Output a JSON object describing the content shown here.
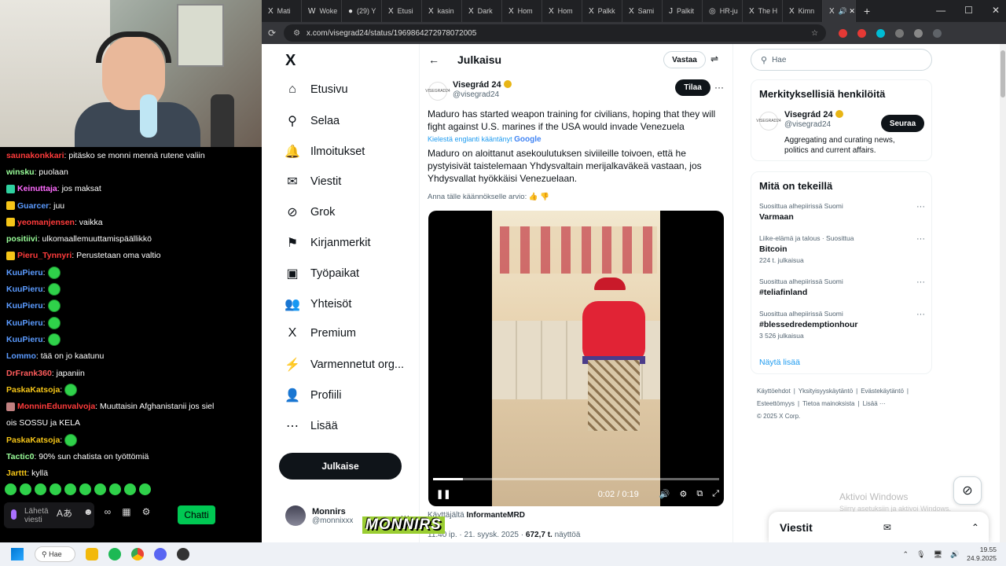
{
  "chat": {
    "messages": [
      {
        "user": "saunakonkkari",
        "user_color": "#ff3b3b",
        "text": ": pitäsko se monni mennä rutene valiin",
        "badge": ""
      },
      {
        "user": "winsku",
        "user_color": "#9aff9a",
        "text": ": puolaan",
        "badge": ""
      },
      {
        "user": "Keinuttaja",
        "user_color": "#ff6bff",
        "text": ": jos maksat",
        "badge": "#2fd1a0"
      },
      {
        "user": "Guarcer",
        "user_color": "#5b9bff",
        "text": ": juu",
        "badge": "#f5c518"
      },
      {
        "user": "yeomanjensen",
        "user_color": "#ff3b3b",
        "text": ": vaikka",
        "badge": "#f5c518"
      },
      {
        "user": "positiivi",
        "user_color": "#9aff9a",
        "text": ": ulkomaallemuuttamispäällikkö",
        "badge": ""
      },
      {
        "user": "Pieru_Tynnyri",
        "user_color": "#ff3b3b",
        "text": ": Perustetaan oma valtio",
        "badge": "#f5c518"
      },
      {
        "user": "KuuPieru",
        "user_color": "#5b9bff",
        "text": ":",
        "badge": "",
        "emote": true
      },
      {
        "user": "KuuPieru",
        "user_color": "#5b9bff",
        "text": ":",
        "badge": "",
        "emote": true
      },
      {
        "user": "KuuPieru",
        "user_color": "#5b9bff",
        "text": ":",
        "badge": "",
        "emote": true
      },
      {
        "user": "KuuPieru",
        "user_color": "#5b9bff",
        "text": ":",
        "badge": "",
        "emote": true
      },
      {
        "user": "KuuPieru",
        "user_color": "#5b9bff",
        "text": ":",
        "badge": "",
        "emote": true
      },
      {
        "user": "Lommo",
        "user_color": "#5b9bff",
        "text": ": tää on jo kaatunu",
        "badge": ""
      },
      {
        "user": "DrFrank360",
        "user_color": "#ff5c5c",
        "text": ": japaniin",
        "badge": ""
      },
      {
        "user": "PaskaKatsoja",
        "user_color": "#f5c518",
        "text": ":",
        "badge": "",
        "emote": true
      },
      {
        "user": "MonninEdunvalvoja",
        "user_color": "#ff3b3b",
        "text": ": Muuttaisin Afghanistanii jos siel",
        "badge": "#c08080"
      },
      {
        "user": "",
        "user_color": "#fff",
        "text": "ois SOSSU ja KELA",
        "badge": ""
      },
      {
        "user": "PaskaKatsoja",
        "user_color": "#f5c518",
        "text": ":",
        "badge": "",
        "emote": true
      },
      {
        "user": "Tactic0",
        "user_color": "#9aff9a",
        "text": ": 90% sun chatista on työttömiä",
        "badge": ""
      },
      {
        "user": "Jarttt",
        "user_color": "#f5c518",
        "text": ": kyllä",
        "badge": ""
      }
    ],
    "input_placeholder_line1": "Lähetä",
    "input_placeholder_line2": "viesti",
    "chat_button": "Chatti"
  },
  "browser": {
    "tabs": [
      {
        "label": "Mati",
        "icon": "X"
      },
      {
        "label": "Woke",
        "icon": "W"
      },
      {
        "label": "(29) Y",
        "icon": "●"
      },
      {
        "label": "Etusi",
        "icon": "X"
      },
      {
        "label": "kasin",
        "icon": "X"
      },
      {
        "label": "Dark",
        "icon": "X"
      },
      {
        "label": "Hom",
        "icon": "X"
      },
      {
        "label": "Hom",
        "icon": "X"
      },
      {
        "label": "Palkk",
        "icon": "X"
      },
      {
        "label": "Sami",
        "icon": "X"
      },
      {
        "label": "Palkit",
        "icon": "J"
      },
      {
        "label": "HR-ju",
        "icon": "◎"
      },
      {
        "label": "The H",
        "icon": "X"
      },
      {
        "label": "Kimn",
        "icon": "X"
      }
    ],
    "url": "x.com/visegrad24/status/1969864272978072005"
  },
  "x": {
    "nav": [
      {
        "label": "Etusivu",
        "icon": "⌂",
        "name": "nav-home"
      },
      {
        "label": "Selaa",
        "icon": "⚲",
        "name": "nav-explore"
      },
      {
        "label": "Ilmoitukset",
        "icon": "🔔",
        "name": "nav-notifications"
      },
      {
        "label": "Viestit",
        "icon": "✉",
        "name": "nav-messages"
      },
      {
        "label": "Grok",
        "icon": "⊘",
        "name": "nav-grok"
      },
      {
        "label": "Kirjanmerkit",
        "icon": "⚑",
        "name": "nav-bookmarks"
      },
      {
        "label": "Työpaikat",
        "icon": "▣",
        "name": "nav-jobs"
      },
      {
        "label": "Yhteisöt",
        "icon": "👥",
        "name": "nav-communities"
      },
      {
        "label": "Premium",
        "icon": "X",
        "name": "nav-premium"
      },
      {
        "label": "Varmennetut org...",
        "icon": "⚡",
        "name": "nav-verified-orgs"
      },
      {
        "label": "Profiili",
        "icon": "👤",
        "name": "nav-profile"
      },
      {
        "label": "Lisää",
        "icon": "⋯",
        "name": "nav-more"
      }
    ],
    "post_button": "Julkaise",
    "account": {
      "name": "Monnirs",
      "handle": "@monnixxx"
    },
    "header_title": "Julkaisu",
    "reply_button": "Vastaa",
    "tweet": {
      "author_name": "Visegrád 24",
      "author_handle": "@visegrad24",
      "avatar_text": "VISEGRAD24",
      "follow_button": "Tilaa",
      "text": "Maduro has started weapon training for civilians, hoping that they will fight against U.S. marines if the USA would invade Venezuela",
      "translated_by": "Kielestä englanti kääntänyt",
      "translated_by_brand": "Google",
      "translated_text": "Maduro on aloittanut asekoulutuksen siviileille toivoen, että he pystyisivät taistelemaan Yhdysvaltain merijalkaväkeä vastaan, jos Yhdysvallat hyökkäisi Venezuelaan.",
      "rate_translation": "Anna tälle käännökselle arvio:",
      "video_time": "0:02 / 0:19",
      "video_progress": 0.105,
      "caption_prefix": "Käyttäjältä",
      "caption_user": "InformanteMRD",
      "meta_time": "11.40 ip. · 21. syysk. 2025 ·",
      "meta_views": "672,7 t.",
      "meta_views_label": "näyttöä"
    },
    "search_placeholder": "Hae",
    "who": {
      "title": "Merkityksellisiä henkilöitä",
      "name": "Visegrád 24",
      "handle": "@visegrad24",
      "bio": "Aggregating and curating news, politics and current affairs.",
      "button": "Seuraa",
      "avatar_text": "VISEGRAD24"
    },
    "trends": {
      "title": "Mitä on tekeillä",
      "items": [
        {
          "context": "Suosittua alhepiirissä Suomi",
          "title": "Varmaan",
          "count": ""
        },
        {
          "context": "Liike-elämä ja talous · Suosittua",
          "title": "Bitcoin",
          "count": "224 t. julkaisua"
        },
        {
          "context": "Suosittua alhepiirissä Suomi",
          "title": "#teliafinland",
          "count": ""
        },
        {
          "context": "Suosittua alhepiirissä Suomi",
          "title": "#blessedredemptionhour",
          "count": "3 526 julkaisua"
        }
      ],
      "show_more": "Näytä lisää"
    },
    "footer": [
      "Käyttöehdot",
      "|",
      "Yksityisyyskäytäntö",
      "|",
      "Evästekäytäntö",
      "|",
      "Esteettömyys",
      "|",
      "Tietoa mainoksista",
      "|",
      "Lisää ···",
      "© 2025 X Corp."
    ],
    "messages_drawer": "Viestit"
  },
  "windows": {
    "activate_title": "Aktivoi Windows",
    "activate_sub": "Siirry asetuksiin ja aktivoi Windows.",
    "taskbar_search": "Hae",
    "clock_time": "19.55",
    "clock_date": "24.9.2025"
  },
  "watermark": "MONNIRS"
}
